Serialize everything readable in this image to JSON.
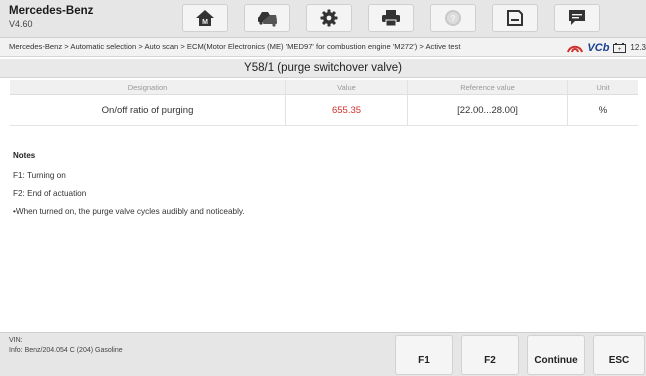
{
  "app": {
    "brand": "Mercedes-Benz",
    "version": "V4.60"
  },
  "toolbar": {
    "icons": [
      "home-icon",
      "vehicle-swap-icon",
      "gear-icon",
      "printer-icon",
      "help-icon",
      "save-icon",
      "message-icon"
    ]
  },
  "breadcrumb": "Mercedes-Benz > Automatic selection > Auto scan > ECM(Motor Electronics (ME) 'MED97' for combustion engine 'M272') > Active test",
  "status": {
    "vci_label": "VCb",
    "time": "12.3"
  },
  "page_title": "Y58/1 (purge switchover valve)",
  "table": {
    "headers": [
      "Designation",
      "Value",
      "Reference value",
      "Unit"
    ],
    "rows": [
      {
        "designation": "On/off ratio of purging",
        "value": "655.35",
        "reference": "[22.00...28.00]",
        "unit": "%"
      }
    ]
  },
  "notes": {
    "title": "Notes",
    "lines": [
      "F1: Turning on",
      "F2: End of actuation",
      "•When turned on, the purge valve cycles audibly and noticeably."
    ]
  },
  "footer": {
    "vin_label": "VIN:",
    "info": "Info: Benz/204.054 C (204) Gasoline",
    "buttons": {
      "f1": "F1",
      "f2": "F2",
      "continue": "Continue",
      "esc": "ESC"
    }
  },
  "colors": {
    "value_out_of_range": "#d0302b",
    "vci_red": "#d0302b",
    "vci_blue": "#1d3f8f"
  }
}
